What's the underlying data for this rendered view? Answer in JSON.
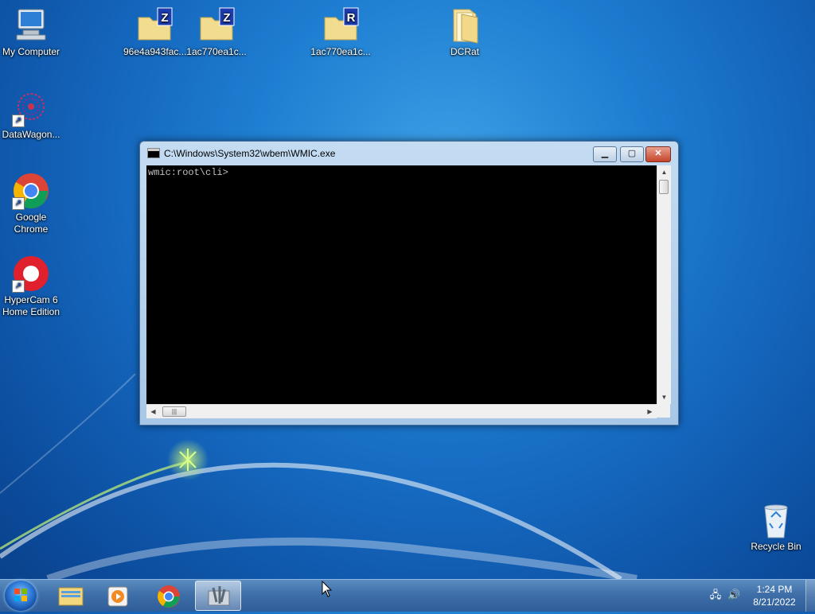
{
  "desktop": {
    "icons": [
      {
        "label": "My Computer"
      },
      {
        "label": "96e4a943fac..."
      },
      {
        "label": "1ac770ea1c..."
      },
      {
        "label": "1ac770ea1c..."
      },
      {
        "label": "DCRat"
      },
      {
        "label": "DataWagon..."
      },
      {
        "label": "Google Chrome"
      },
      {
        "label": "HyperCam 6 Home Edition"
      },
      {
        "label": "Recycle Bin"
      }
    ],
    "archive_badges": [
      "Z",
      "Z",
      "R"
    ]
  },
  "window": {
    "title": "C:\\Windows\\System32\\wbem\\WMIC.exe",
    "console_text": "wmic:root\\cli>"
  },
  "taskbar": {
    "clock_time": "1:24 PM",
    "clock_date": "8/21/2022"
  }
}
